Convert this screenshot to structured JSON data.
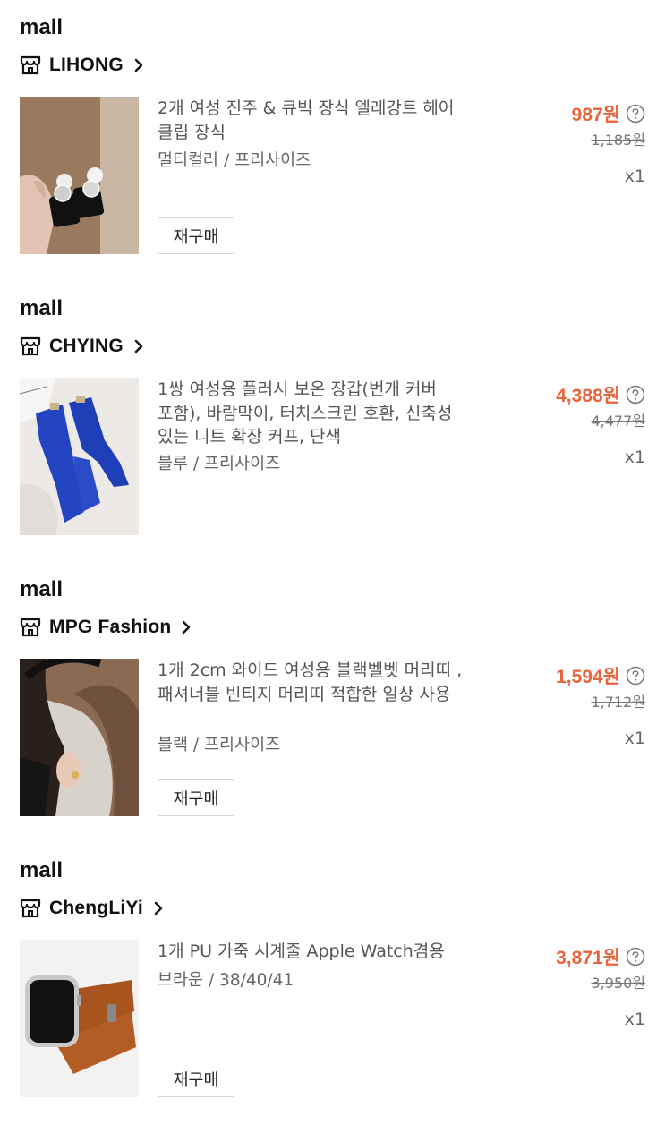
{
  "orders": [
    {
      "mall_label": "mall",
      "shop_name": "LIHONG",
      "title": "2개 여성 진주 & 큐빅 장식 엘레강트 헤어 클립 장식",
      "option": "멀티컬러 / 프리사이즈",
      "price": "987원",
      "original_price": "1,185원",
      "quantity": "x1",
      "rebuy_label": "재구매",
      "thumbnail": "pearl-hair-clips"
    },
    {
      "mall_label": "mall",
      "shop_name": "CHYING",
      "title": "1쌍 여성용 플러시 보온 장갑(번개 커버 포함), 바람막이, 터치스크린 호환, 신축성 있는 니트 확장 커프, 단색",
      "option": "블루 / 프리사이즈",
      "price": "4,388원",
      "original_price": "4,477원",
      "quantity": "x1",
      "rebuy_label": "",
      "thumbnail": "blue-knit-gloves"
    },
    {
      "mall_label": "mall",
      "shop_name": "MPG Fashion",
      "title": "1개 2cm 와이드 여성용 블랙벨벳 머리띠 , 패셔너블 빈티지 머리띠 적합한 일상 사용",
      "option": "블랙 / 프리사이즈",
      "price": "1,594원",
      "original_price": "1,712원",
      "quantity": "x1",
      "rebuy_label": "재구매",
      "thumbnail": "black-velvet-headband"
    },
    {
      "mall_label": "mall",
      "shop_name": "ChengLiYi",
      "title": "1개 PU 가죽 시계줄 Apple Watch겸용",
      "option": "브라운 / 38/40/41",
      "price": "3,871원",
      "original_price": "3,950원",
      "quantity": "x1",
      "rebuy_label": "재구매",
      "thumbnail": "brown-leather-watch-band"
    }
  ],
  "colors": {
    "price": "#e8643a",
    "text_primary": "#111111",
    "text_secondary": "#555555",
    "border": "#d6d6d6"
  },
  "icons": [
    "store-icon",
    "chevron-right-icon",
    "help-circle-icon"
  ]
}
